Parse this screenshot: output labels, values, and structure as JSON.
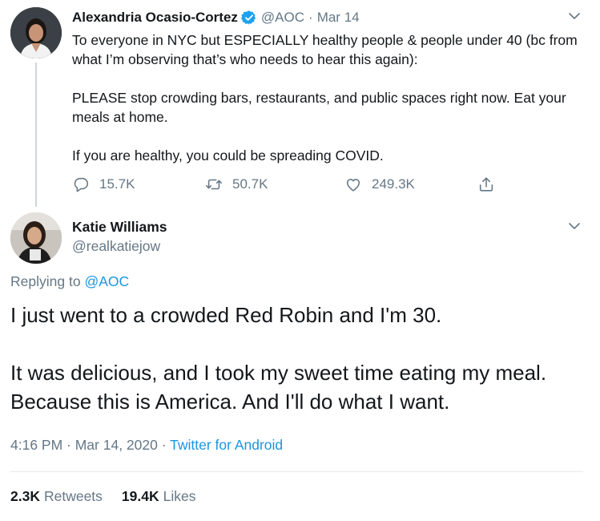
{
  "parent_tweet": {
    "author_name": "Alexandria Ocasio-Cortez",
    "handle": "@AOC",
    "separator": "·",
    "date": "Mar 14",
    "paragraphs": [
      "To everyone in NYC but ESPECIALLY healthy people & people under 40 (bc from what I’m observing that’s who needs to hear this again):",
      "PLEASE stop crowding bars, restaurants, and public spaces right now. Eat your meals at home.",
      "If you are healthy, you could be spreading COVID."
    ],
    "actions": {
      "reply_count": "15.7K",
      "retweet_count": "50.7K",
      "like_count": "249.3K"
    }
  },
  "reply_tweet": {
    "author_name": "Katie Williams",
    "handle": "@realkatiejow",
    "replying_prefix": "Replying to",
    "replying_to": "@AOC",
    "paragraphs": [
      "I just went to a crowded Red Robin and I'm 30.",
      "It was delicious, and I took my sweet time eating my meal. Because this is America. And I'll do what I want."
    ],
    "timestamp": "4:16 PM · Mar 14, 2020",
    "separator": "·",
    "source": "Twitter for Android",
    "retweets_count": "2.3K",
    "retweets_label": "Retweets",
    "likes_count": "19.4K",
    "likes_label": "Likes"
  },
  "colors": {
    "text": "#14171a",
    "secondary": "#657786",
    "link": "#1b95e0",
    "verified": "#1da1f2",
    "divider": "#e6ecf0"
  },
  "icons": {
    "verified": "verified-badge-icon",
    "reply": "reply-icon",
    "retweet": "retweet-icon",
    "like": "heart-icon",
    "share": "share-icon",
    "more": "chevron-down-icon"
  }
}
